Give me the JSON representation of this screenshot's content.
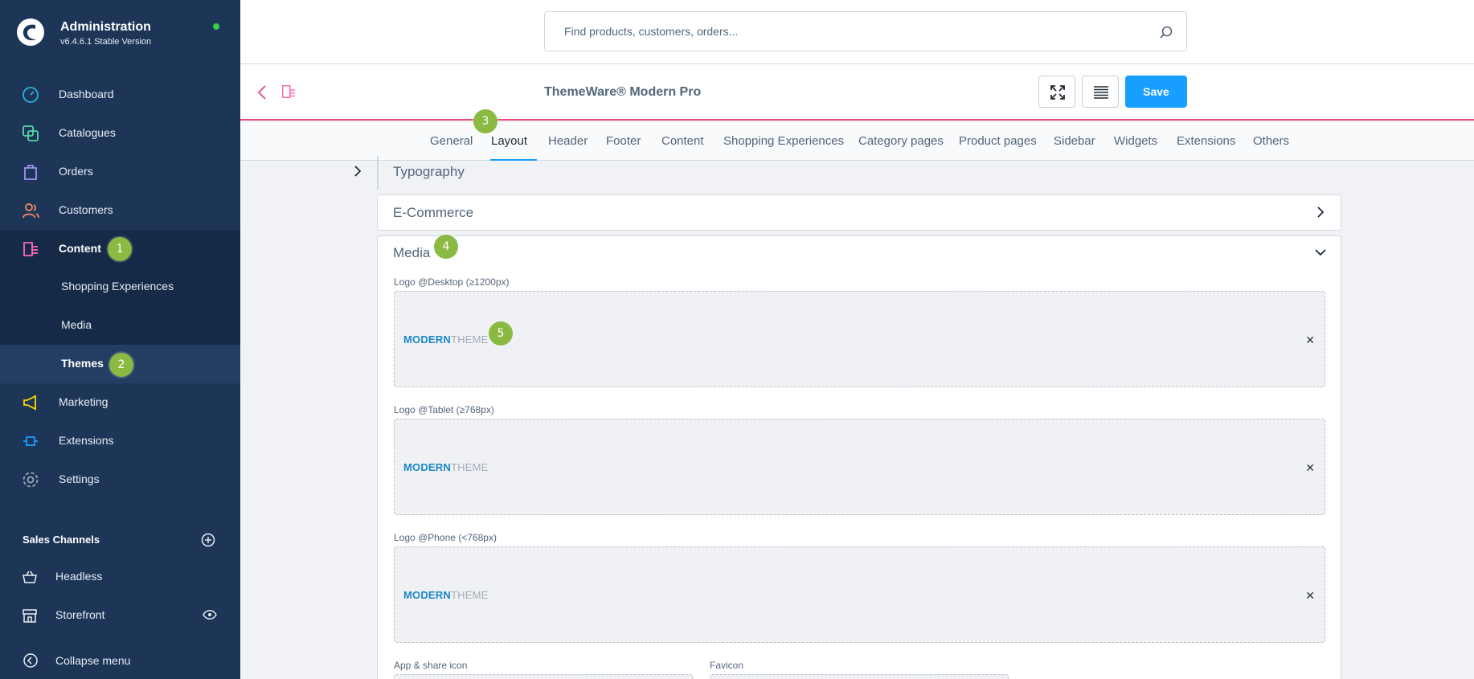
{
  "app": {
    "title": "Administration",
    "version": "v6.4.6.1 Stable Version"
  },
  "sidebar": {
    "items": [
      {
        "label": "Dashboard",
        "icon": "dashboard-icon"
      },
      {
        "label": "Catalogues",
        "icon": "catalogues-icon"
      },
      {
        "label": "Orders",
        "icon": "orders-icon"
      },
      {
        "label": "Customers",
        "icon": "customers-icon"
      },
      {
        "label": "Content",
        "icon": "content-icon"
      },
      {
        "label": "Marketing",
        "icon": "marketing-icon"
      },
      {
        "label": "Extensions",
        "icon": "extensions-icon"
      },
      {
        "label": "Settings",
        "icon": "settings-icon"
      }
    ],
    "content_sub": [
      "Shopping Experiences",
      "Media",
      "Themes"
    ],
    "sales_channels_title": "Sales Channels",
    "sales_channels": [
      "Headless",
      "Storefront"
    ],
    "collapse_label": "Collapse menu"
  },
  "search": {
    "placeholder": "Find products, customers, orders..."
  },
  "smartbar": {
    "title": "ThemeWare® Modern Pro",
    "save_label": "Save"
  },
  "tabs": [
    "General",
    "Layout",
    "Header",
    "Footer",
    "Content",
    "Shopping Experiences",
    "Category pages",
    "Product pages",
    "Sidebar",
    "Widgets",
    "Extensions",
    "Others"
  ],
  "active_tab": "Layout",
  "sections": {
    "typography": "Typography",
    "ecommerce": "E-Commerce",
    "media": "Media"
  },
  "media_fields": [
    {
      "label": "Logo @Desktop (≥1200px)",
      "logo_bold": "MODERN",
      "logo_light": "THEME"
    },
    {
      "label": "Logo @Tablet (≥768px)",
      "logo_bold": "MODERN",
      "logo_light": "THEME"
    },
    {
      "label": "Logo @Phone (<768px)",
      "logo_bold": "MODERN",
      "logo_light": "THEME"
    }
  ],
  "bottom_fields": [
    "App & share icon",
    "Favicon"
  ],
  "badges": [
    "1",
    "2",
    "3",
    "4",
    "5"
  ],
  "colors": {
    "sidebar_bg": "#1d3658",
    "primary": "#189eff",
    "accent_pink": "#e5487b",
    "badge_green": "#8bba42",
    "status_online": "#37d046"
  }
}
